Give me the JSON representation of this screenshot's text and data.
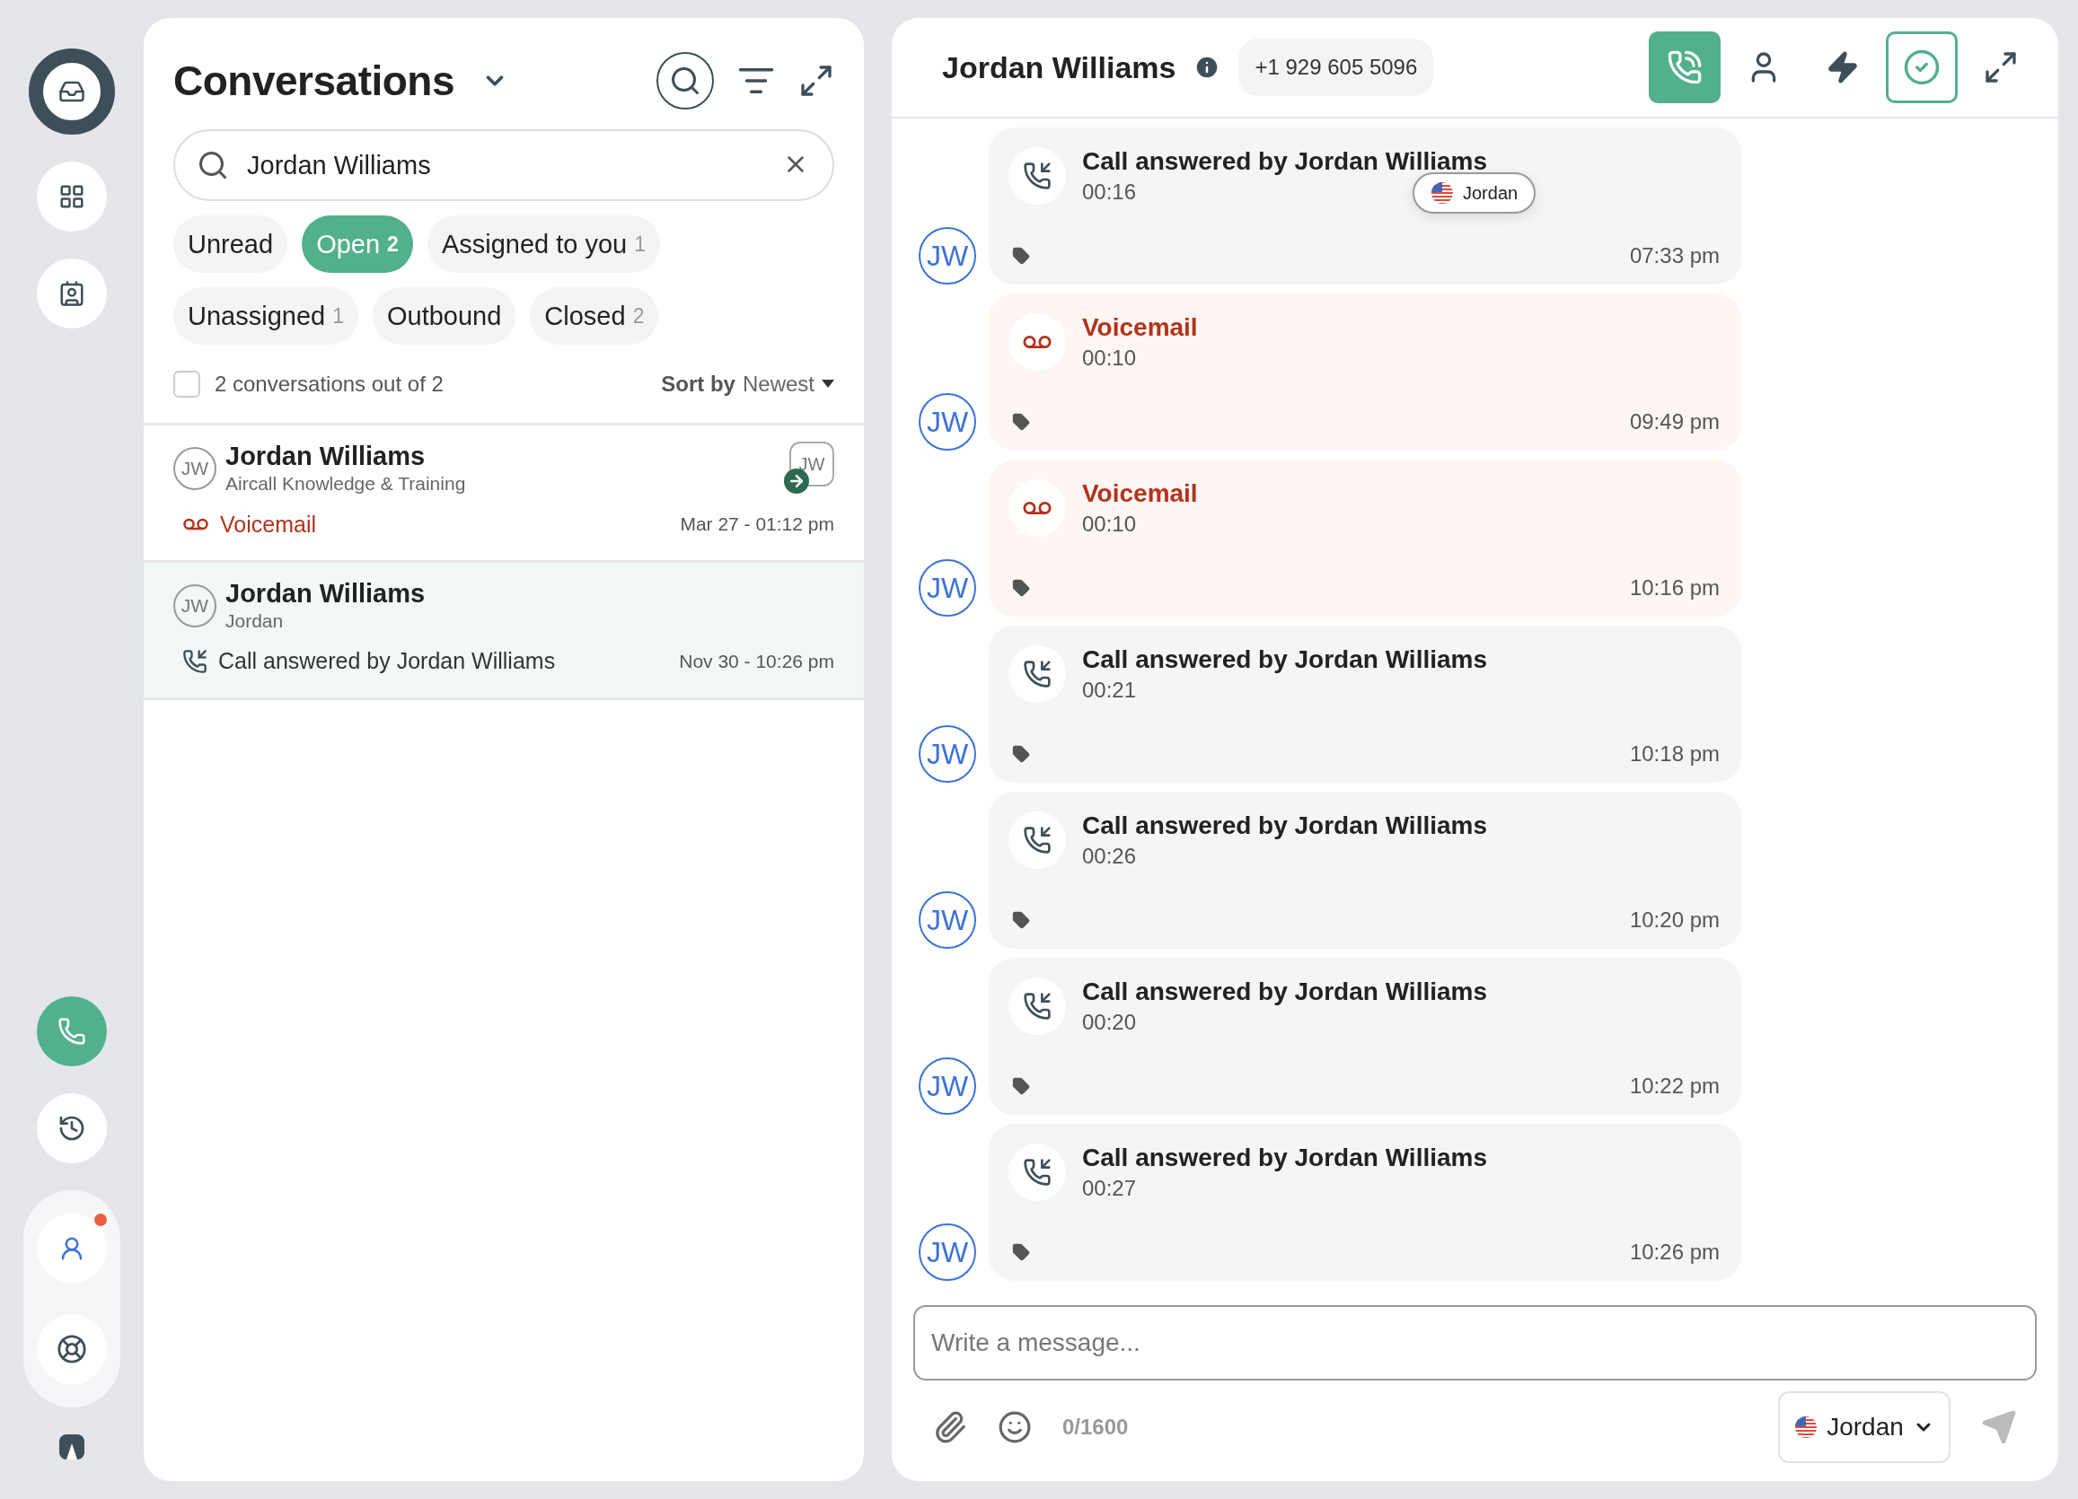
{
  "rail": [
    {
      "selected": true,
      "accent": false,
      "notification": false
    },
    {
      "selected": false,
      "accent": false,
      "notification": false
    },
    {
      "selected": false,
      "accent": false,
      "notification": false
    },
    {
      "selected": false,
      "accent": true,
      "notification": false
    },
    {
      "selected": false,
      "accent": false,
      "notification": false
    },
    {
      "selected": false,
      "accent": false,
      "notification": true
    },
    {
      "selected": false,
      "accent": false,
      "notification": false
    }
  ],
  "conversations": {
    "title": "Conversations",
    "search": {
      "value": "Jordan Williams"
    },
    "filters": [
      {
        "label": "Unread",
        "selected": false
      },
      {
        "label": "Open",
        "count": "2",
        "selected": true
      },
      {
        "label": "Assigned to you",
        "count": "1",
        "selected": false
      },
      {
        "label": "Unassigned",
        "count": "1",
        "selected": false
      },
      {
        "label": "Outbound",
        "selected": false
      },
      {
        "label": "Closed",
        "count": "2",
        "selected": false
      }
    ],
    "select_all": {
      "checked": false,
      "label": "2 conversations out of 2"
    },
    "sort": {
      "label": "Sort by",
      "value": "Newest"
    },
    "items": [
      {
        "initials": "JW",
        "name": "Jordan Williams",
        "subtitle": "Aircall Knowledge & Training",
        "kind": "voicemail",
        "preview": "Voicemail",
        "time": "Mar 27 - 01:12 pm",
        "assignee": "JW",
        "selected": false
      },
      {
        "initials": "JW",
        "name": "Jordan Williams",
        "subtitle": "Jordan",
        "kind": "answered",
        "preview": "Call answered by Jordan Williams",
        "time": "Nov 30 - 10:26 pm",
        "selected": true
      }
    ]
  },
  "chat": {
    "contact": "Jordan Williams",
    "phone": "+1 929 605 5096",
    "messages": [
      {
        "initials": "JW",
        "kind": "answered",
        "title": "Call answered by Jordan Williams",
        "duration": "00:16",
        "time": "07:33 pm",
        "line_tag": "Jordan"
      },
      {
        "initials": "JW",
        "kind": "voicemail",
        "title": "Voicemail",
        "duration": "00:10",
        "time": "09:49 pm"
      },
      {
        "initials": "JW",
        "kind": "voicemail",
        "title": "Voicemail",
        "duration": "00:10",
        "time": "10:16 pm"
      },
      {
        "initials": "JW",
        "kind": "answered",
        "title": "Call answered by Jordan Williams",
        "duration": "00:21",
        "time": "10:18 pm"
      },
      {
        "initials": "JW",
        "kind": "answered",
        "title": "Call answered by Jordan Williams",
        "duration": "00:26",
        "time": "10:20 pm"
      },
      {
        "initials": "JW",
        "kind": "answered",
        "title": "Call answered by Jordan Williams",
        "duration": "00:20",
        "time": "10:22 pm"
      },
      {
        "initials": "JW",
        "kind": "answered",
        "title": "Call answered by Jordan Williams",
        "duration": "00:27",
        "time": "10:26 pm"
      }
    ],
    "composer": {
      "placeholder": "Write a message...",
      "counter": "0/1600",
      "line": "Jordan"
    }
  }
}
